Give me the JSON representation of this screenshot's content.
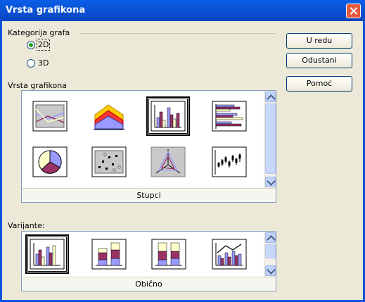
{
  "window": {
    "title": "Vrsta grafikona"
  },
  "category": {
    "label": "Kategorija grafa",
    "options": [
      {
        "label": "2D",
        "checked": true
      },
      {
        "label": "3D",
        "checked": false
      }
    ]
  },
  "buttons": {
    "ok": "U redu",
    "cancel": "Odustani",
    "help": "Pomoć"
  },
  "chart_types": {
    "label": "Vrsta grafikona",
    "selected_caption": "Stupci",
    "items": [
      {
        "icon": "line-chart-icon"
      },
      {
        "icon": "area-chart-icon"
      },
      {
        "icon": "column-chart-icon",
        "selected": true
      },
      {
        "icon": "bar-chart-icon"
      },
      {
        "icon": "pie-chart-icon"
      },
      {
        "icon": "xy-scatter-icon"
      },
      {
        "icon": "net-chart-icon"
      },
      {
        "icon": "stock-chart-icon"
      }
    ]
  },
  "variants": {
    "label": "Varijante:",
    "selected_caption": "Obično",
    "items": [
      {
        "icon": "normal-column-icon",
        "selected": true
      },
      {
        "icon": "stacked-column-icon"
      },
      {
        "icon": "percent-stacked-column-icon"
      },
      {
        "icon": "column-and-line-icon"
      }
    ]
  },
  "colors": {
    "title_bar": "#0b4fd0",
    "accent_purple": "#993366",
    "accent_blue": "#9999ff",
    "accent_yellow": "#ffffcc"
  }
}
